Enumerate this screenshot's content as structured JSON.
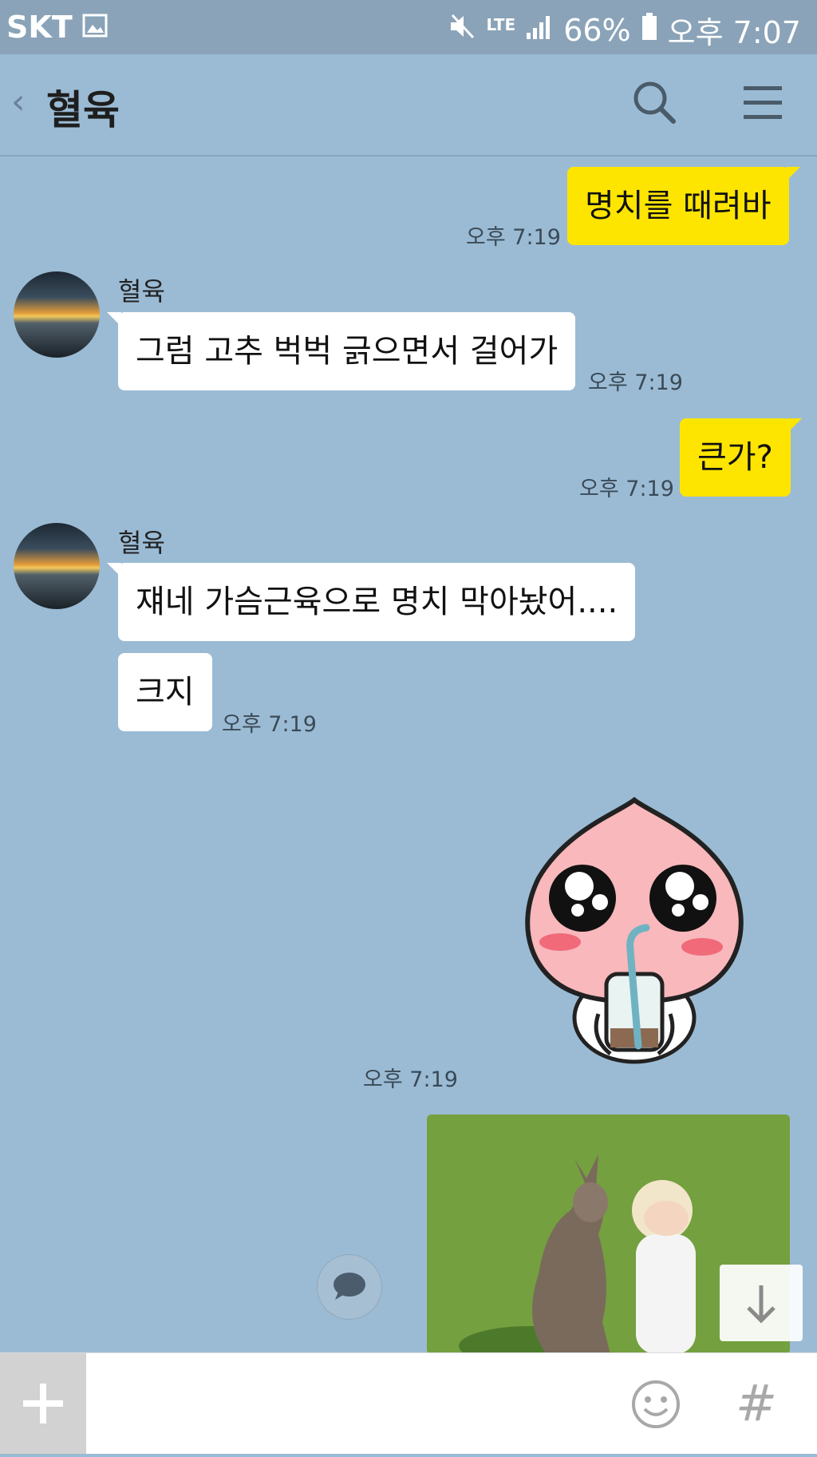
{
  "status_bar": {
    "carrier": "SKT",
    "network": "LTE",
    "battery": "66%",
    "time": "오후 7:07"
  },
  "header": {
    "title": "혈육",
    "back_glyph": "‹"
  },
  "messages": [
    {
      "from": "me",
      "text": "명치를 때려바",
      "time": "오후 7:19"
    },
    {
      "from": "other",
      "sender": "혈육",
      "text": "그럼 고추 벅벅 긁으면서 걸어가",
      "time": "오후 7:19"
    },
    {
      "from": "me",
      "text": "큰가?",
      "time": "오후 7:19"
    },
    {
      "from": "other",
      "sender": "혈육",
      "text": "쟤네 가슴근육으로 명치 막아놨어...."
    },
    {
      "from": "other",
      "text": "크지",
      "time": "오후 7:19"
    },
    {
      "from": "me",
      "type": "sticker",
      "time": "오후 7:19"
    },
    {
      "from": "me",
      "type": "photo"
    }
  ],
  "input": {
    "placeholder": "",
    "hash_glyph": "#"
  },
  "colors": {
    "background": "#9bbbd4",
    "my_bubble": "#fee500",
    "other_bubble": "#ffffff"
  },
  "icons": [
    "image-icon",
    "mute-icon",
    "signal-icon",
    "battery-icon",
    "search-icon",
    "menu-icon",
    "emoji-icon",
    "plus-icon",
    "arrow-down-icon",
    "chat-bubble-icon"
  ]
}
